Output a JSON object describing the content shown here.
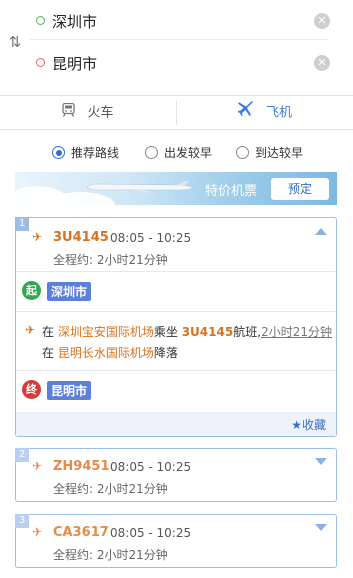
{
  "route": {
    "from": "深圳市",
    "to": "昆明市"
  },
  "tabs": {
    "train": "火车",
    "plane": "飞机"
  },
  "sort_options": [
    {
      "label": "推荐路线",
      "checked": true
    },
    {
      "label": "出发较早",
      "checked": false
    },
    {
      "label": "到达较早",
      "checked": false
    }
  ],
  "banner": {
    "text": "特价机票",
    "button": "预定"
  },
  "flights": [
    {
      "index": "1",
      "flight_no": "3U4145",
      "time": "08:05 - 10:25",
      "duration": "全程约: 2小时21分钟",
      "expanded": true,
      "start_badge": "起",
      "start_city": "深圳市",
      "end_badge": "终",
      "end_city": "昆明市",
      "segment": {
        "prefix": "在",
        "dep_airport": "深圳宝安国际机场",
        "take": "乘坐",
        "flight_no": "3U4145",
        "suffix": "航班,",
        "duration": "2小时21分钟",
        "line2_prefix": "在",
        "arr_airport": "昆明长水国际机场",
        "land": "降落"
      },
      "favorite": "收藏"
    },
    {
      "index": "2",
      "flight_no": "ZH9451",
      "time": "08:05 - 10:25",
      "duration": "全程约: 2小时21分钟",
      "expanded": false
    },
    {
      "index": "3",
      "flight_no": "CA3617",
      "time": "08:05 - 10:25",
      "duration": "全程约: 2小时21分钟",
      "expanded": false
    }
  ],
  "colors": {
    "accent": "#2f6fce",
    "flight_orange": "#d9711e",
    "card_border": "#9dbde6"
  }
}
